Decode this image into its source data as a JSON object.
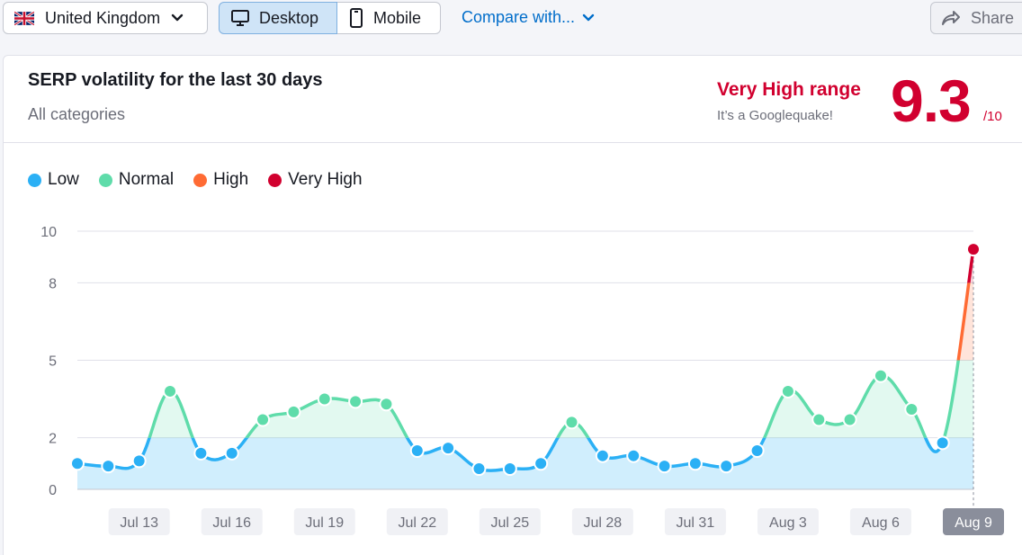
{
  "toolbar": {
    "country_label": "United Kingdom",
    "device_desktop": "Desktop",
    "device_mobile": "Mobile",
    "compare_label": "Compare with...",
    "share_label": "Share"
  },
  "card": {
    "title": "SERP volatility for the last 30 days",
    "subtitle": "All categories",
    "range_label": "Very High range",
    "range_sub": "It’s a Googlequake!",
    "score": "9.3",
    "score_max": "/10"
  },
  "colors": {
    "low": "#2bb0f5",
    "normal": "#5fdcaa",
    "high": "#ff6b34",
    "very_high": "#d1002f",
    "accent": "#006dca"
  },
  "chart_data": {
    "type": "area",
    "legend": [
      "Low",
      "Normal",
      "High",
      "Very High"
    ],
    "legend_position": "top-left",
    "ylim": [
      0,
      10
    ],
    "y_ticks": [
      0,
      2,
      5,
      8,
      10
    ],
    "thresholds": {
      "low_max": 2,
      "normal_max": 5,
      "high_max": 8
    },
    "x_tick_labels": [
      "Jul 13",
      "Jul 16",
      "Jul 19",
      "Jul 22",
      "Jul 25",
      "Jul 28",
      "Jul 31",
      "Aug 3",
      "Aug 6",
      "Aug 9"
    ],
    "x_tick_indices": [
      2,
      5,
      8,
      11,
      14,
      17,
      20,
      23,
      26,
      29
    ],
    "active_label": "Aug 9",
    "x": [
      "Jul 11",
      "Jul 12",
      "Jul 13",
      "Jul 14",
      "Jul 15",
      "Jul 16",
      "Jul 17",
      "Jul 18",
      "Jul 19",
      "Jul 20",
      "Jul 21",
      "Jul 22",
      "Jul 23",
      "Jul 24",
      "Jul 25",
      "Jul 26",
      "Jul 27",
      "Jul 28",
      "Jul 29",
      "Jul 30",
      "Jul 31",
      "Aug 1",
      "Aug 2",
      "Aug 3",
      "Aug 4",
      "Aug 5",
      "Aug 6",
      "Aug 7",
      "Aug 8",
      "Aug 9"
    ],
    "values": [
      1.0,
      0.9,
      1.1,
      3.8,
      1.4,
      1.4,
      2.7,
      3.0,
      3.5,
      3.4,
      3.3,
      1.5,
      1.6,
      0.8,
      0.8,
      1.0,
      2.6,
      1.3,
      1.3,
      0.9,
      1.0,
      0.9,
      1.5,
      3.8,
      2.7,
      2.7,
      4.4,
      3.1,
      1.8,
      9.3
    ],
    "grid": true
  }
}
